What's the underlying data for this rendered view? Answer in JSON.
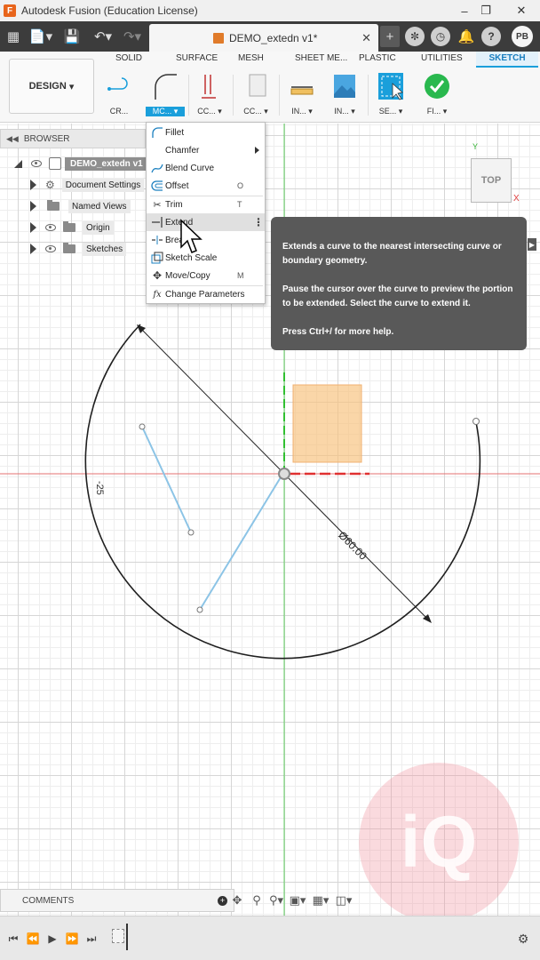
{
  "window": {
    "title": "Autodesk Fusion (Education License)"
  },
  "tabbar": {
    "document_tab": "DEMO_extedn v1*",
    "user_initials": "PB"
  },
  "ribbon": {
    "tabs": [
      "SOLID",
      "SURFACE",
      "MESH",
      "SHEET ME...",
      "PLASTIC",
      "UTILITIES",
      "SKETCH"
    ],
    "active_tab": "SKETCH",
    "workspace_button": "DESIGN",
    "tools": {
      "create": "CR...",
      "modify": "MC...",
      "constraints": "CC...",
      "configure": "CC...",
      "inspect": "IN...",
      "insert": "IN...",
      "select": "SE...",
      "finish": "FI..."
    }
  },
  "browser": {
    "header": "BROWSER",
    "root": "DEMO_extedn v1",
    "items": [
      {
        "label": "Document Settings"
      },
      {
        "label": "Named Views"
      },
      {
        "label": "Origin"
      },
      {
        "label": "Sketches"
      }
    ]
  },
  "modify_menu": {
    "items": [
      {
        "label": "Fillet",
        "shortcut": ""
      },
      {
        "label": "Chamfer",
        "shortcut": ""
      },
      {
        "label": "Blend Curve",
        "shortcut": ""
      },
      {
        "label": "Offset",
        "shortcut": "O"
      },
      {
        "label": "Trim",
        "shortcut": "T"
      },
      {
        "label": "Extend",
        "shortcut": ""
      },
      {
        "label": "Break",
        "shortcut": ""
      },
      {
        "label": "Sketch Scale",
        "shortcut": ""
      },
      {
        "label": "Move/Copy",
        "shortcut": "M"
      },
      {
        "label": "Change Parameters",
        "shortcut": ""
      }
    ]
  },
  "tooltip": {
    "line1": "Extends a curve to the nearest intersecting curve or boundary geometry.",
    "line2": "Pause the cursor over the curve to preview the portion to be extended. Select the curve to extend it.",
    "line3": "Press Ctrl+/ for more help."
  },
  "viewcube": {
    "face": "TOP",
    "axis_x": "X",
    "axis_y": "Y"
  },
  "sketch": {
    "diameter_dim": "Ø60.00",
    "side_dim": "-25"
  },
  "bottom": {
    "comments_label": "COMMENTS"
  },
  "colors": {
    "accent": "#1a9fdb",
    "tooltip_bg": "#595959",
    "x_axis": "#e03030",
    "y_axis": "#30c030",
    "sketch_line": "#8cc4e6"
  }
}
